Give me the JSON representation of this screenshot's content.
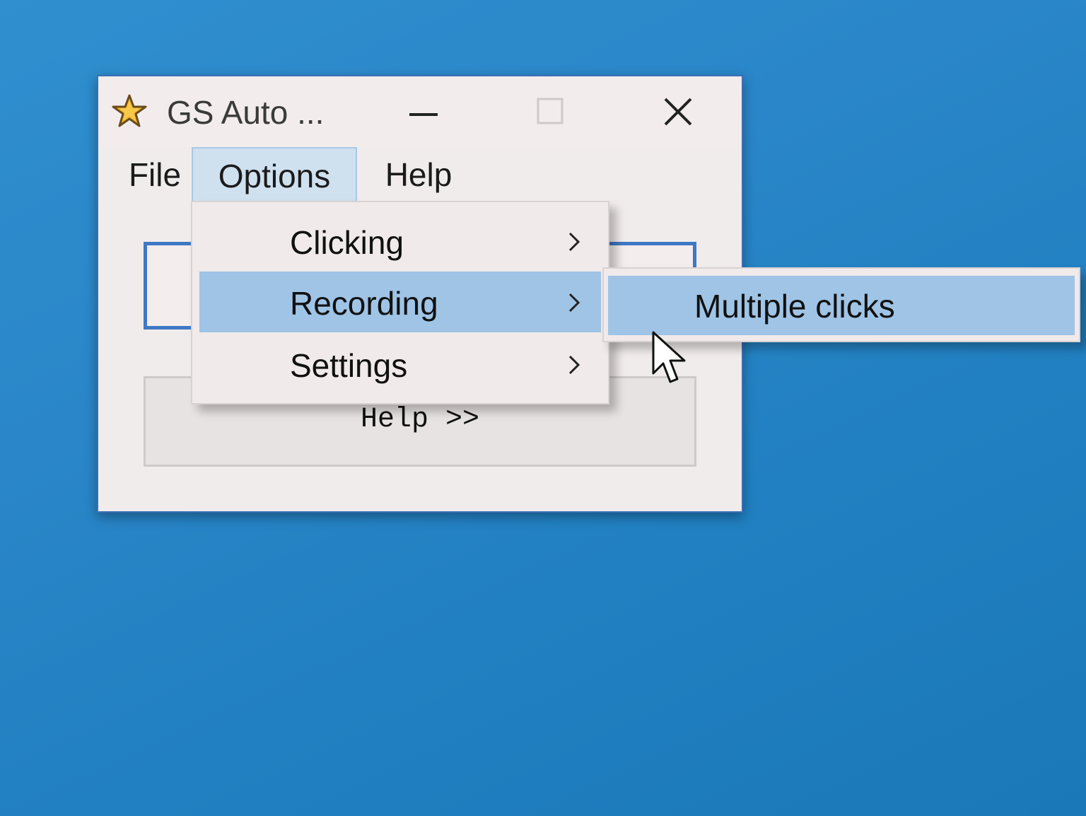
{
  "window": {
    "title": "GS Auto ...",
    "icon": "star-icon",
    "buttons": {
      "minimize": "minimize-icon",
      "maximize": "maximize-icon",
      "close": "close-icon"
    }
  },
  "menubar": {
    "items": [
      {
        "label": "File"
      },
      {
        "label": "Options"
      },
      {
        "label": "Help"
      }
    ]
  },
  "options_menu": {
    "items": [
      {
        "label": "Clicking",
        "has_submenu": true
      },
      {
        "label": "Recording",
        "has_submenu": true,
        "highlighted": true
      },
      {
        "label": "Settings",
        "has_submenu": true
      }
    ]
  },
  "recording_submenu": {
    "items": [
      {
        "label": "Multiple clicks",
        "highlighted": true
      }
    ]
  },
  "content": {
    "help_button_label": "Help >>"
  },
  "colors": {
    "desktop": "#2a86c8",
    "highlight": "#9fc4e6",
    "window_bg": "#f1ecec"
  }
}
